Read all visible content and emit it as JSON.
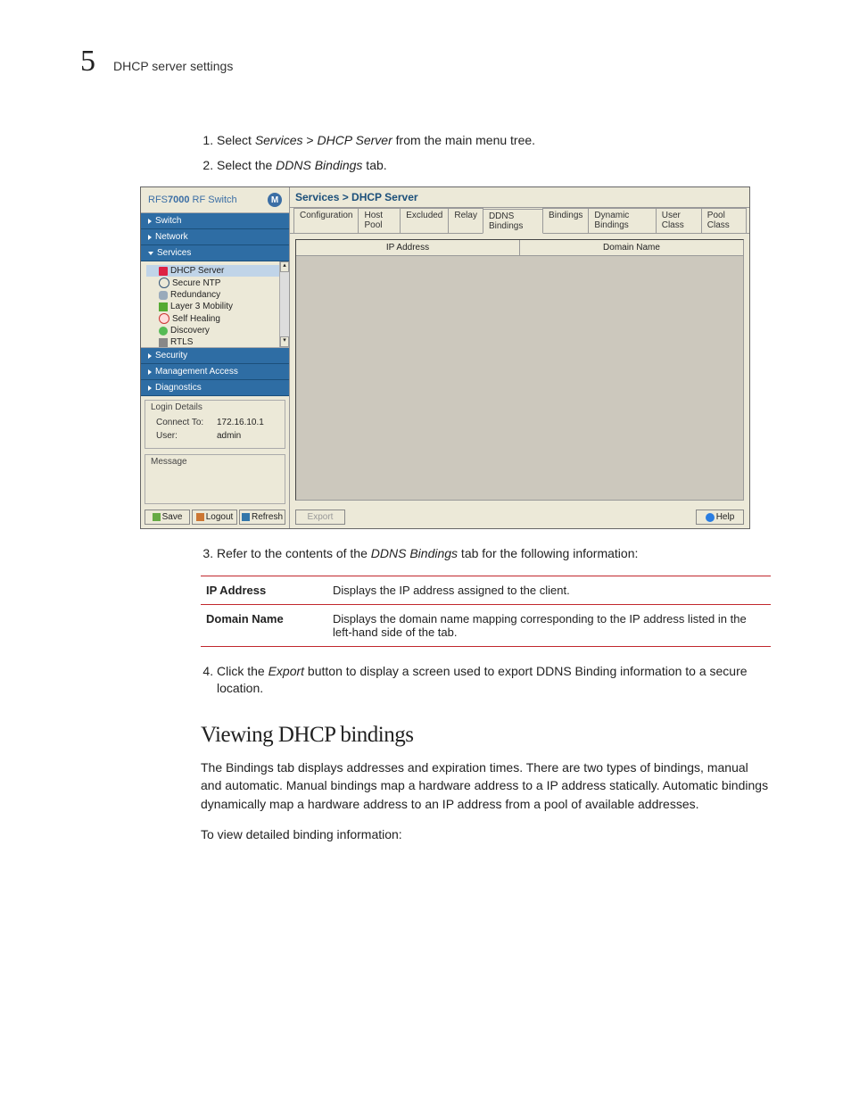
{
  "page": {
    "chapter_number": "5",
    "section_title": "DHCP server settings"
  },
  "steps_a": [
    {
      "prefix": "Select ",
      "em1": "Services",
      "mid": " > ",
      "em2": "DHCP Server",
      "suffix": " from the main menu tree."
    },
    {
      "prefix": "Select the ",
      "em1": "DDNS Bindings",
      "mid": "",
      "em2": "",
      "suffix": " tab."
    }
  ],
  "screenshot": {
    "product_a": "RFS",
    "product_b": "7000",
    "product_c": " RF Switch",
    "moto": "M",
    "nav": {
      "switch": "Switch",
      "network": "Network",
      "services": "Services",
      "security": "Security",
      "mgmt": "Management Access",
      "diag": "Diagnostics"
    },
    "tree": [
      {
        "label": "DHCP Server",
        "icon": "server",
        "selected": true
      },
      {
        "label": "Secure NTP",
        "icon": "clock",
        "selected": false
      },
      {
        "label": "Redundancy",
        "icon": "cloud",
        "selected": false
      },
      {
        "label": "Layer 3 Mobility",
        "icon": "mob",
        "selected": false
      },
      {
        "label": "Self Healing",
        "icon": "heal",
        "selected": false
      },
      {
        "label": "Discovery",
        "icon": "disc",
        "selected": false
      },
      {
        "label": "RTLS",
        "icon": "rtls",
        "selected": false
      }
    ],
    "login": {
      "title": "Login Details",
      "connect_label": "Connect To:",
      "connect_value": "172.16.10.1",
      "user_label": "User:",
      "user_value": "admin"
    },
    "message_title": "Message",
    "buttons": {
      "save": "Save",
      "logout": "Logout",
      "refresh": "Refresh"
    },
    "crumb": "Services > DHCP Server",
    "tabs": [
      "Configuration",
      "Host Pool",
      "Excluded",
      "Relay",
      "DDNS Bindings",
      "Bindings",
      "Dynamic Bindings",
      "User Class",
      "Pool Class"
    ],
    "active_tab_index": 4,
    "columns": [
      "IP Address",
      "Domain Name"
    ],
    "footer": {
      "export": "Export",
      "help": "Help"
    }
  },
  "step3": {
    "prefix": "Refer to the contents of the ",
    "em": "DDNS Bindings",
    "suffix": " tab for the following information:"
  },
  "info_rows": [
    {
      "term": "IP Address",
      "desc": "Displays the IP address assigned to the client."
    },
    {
      "term": "Domain Name",
      "desc": "Displays the domain name mapping corresponding to the IP address listed in the left-hand side of the tab."
    }
  ],
  "step4": {
    "prefix": "Click the ",
    "em": "Export",
    "suffix": " button to display a screen used to export DDNS Binding information to a secure location."
  },
  "subsection": {
    "heading": "Viewing DHCP bindings",
    "para1": "The Bindings tab displays addresses and expiration times. There are two types of bindings, manual and automatic. Manual bindings map a hardware address to a IP address statically. Automatic bindings dynamically map a hardware address to an IP address from a pool of available addresses.",
    "para2": "To view detailed binding information:"
  }
}
